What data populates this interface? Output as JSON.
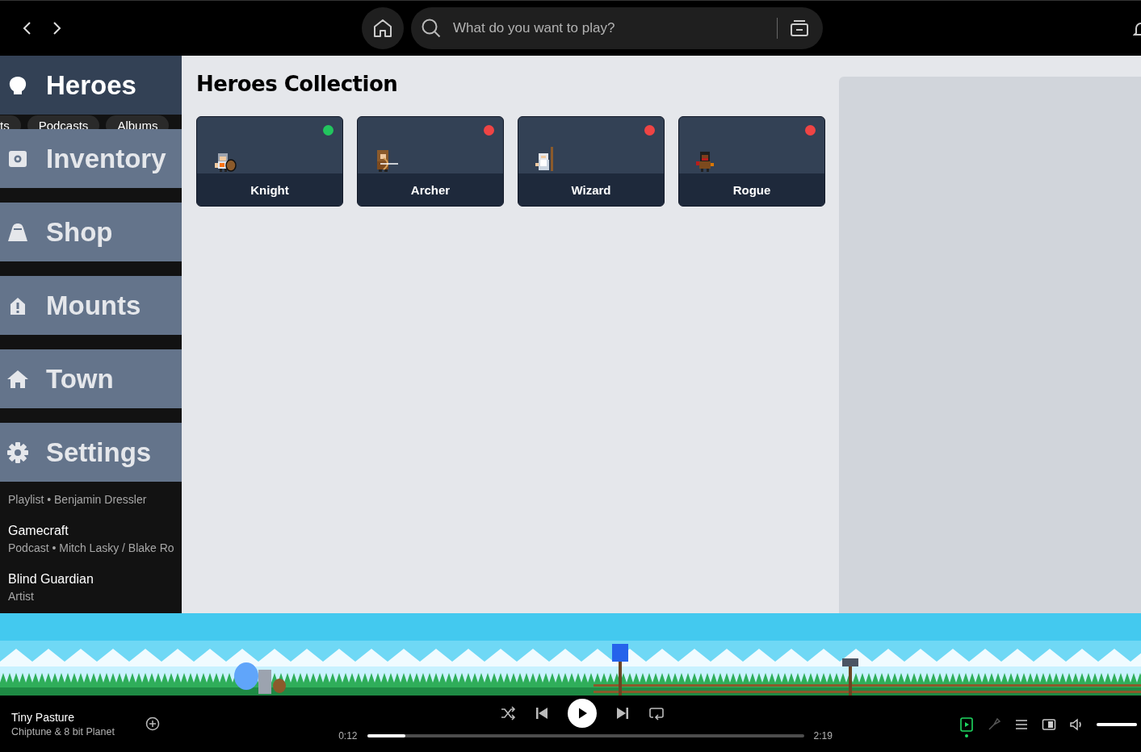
{
  "header": {
    "search": {
      "placeholder": "What do you want to play?"
    }
  },
  "sidebar": {
    "items": [
      {
        "label": "Heroes",
        "kind": "heroes",
        "selected": true
      },
      {
        "label": "Inventory",
        "kind": "inventory",
        "selected": false
      },
      {
        "label": "Shop",
        "kind": "shop",
        "selected": false
      },
      {
        "label": "Mounts",
        "kind": "mounts",
        "selected": false
      },
      {
        "label": "Town",
        "kind": "town",
        "selected": false
      },
      {
        "label": "Settings",
        "kind": "settings",
        "selected": false
      }
    ]
  },
  "library": {
    "filters": [
      "ts",
      "Podcasts",
      "Albums"
    ],
    "items": [
      {
        "subtitle": "Playlist • Benjamin Dressler"
      },
      {
        "title": "Gamecraft",
        "subtitle": "Podcast • Mitch Lasky / Blake Ro"
      },
      {
        "title": "Blind Guardian",
        "subtitle": "Artist"
      }
    ]
  },
  "collection": {
    "title": "Heroes Collection",
    "heroes": [
      {
        "name": "Knight",
        "kind": "knight",
        "color": "#22c55e"
      },
      {
        "name": "Archer",
        "kind": "archer",
        "color": "#ef4444"
      },
      {
        "name": "Wizard",
        "kind": "wizard",
        "color": "#ef4444"
      },
      {
        "name": "Rogue",
        "kind": "rogue",
        "color": "#ef4444"
      }
    ]
  },
  "player": {
    "track": "Tiny Pasture",
    "artist": "Chiptune & 8 bit Planet",
    "elapsed": "0:12",
    "duration": "2:19",
    "level": 0.087,
    "playing": false,
    "now_playing_view": true,
    "volume": {
      "level": 1
    }
  }
}
